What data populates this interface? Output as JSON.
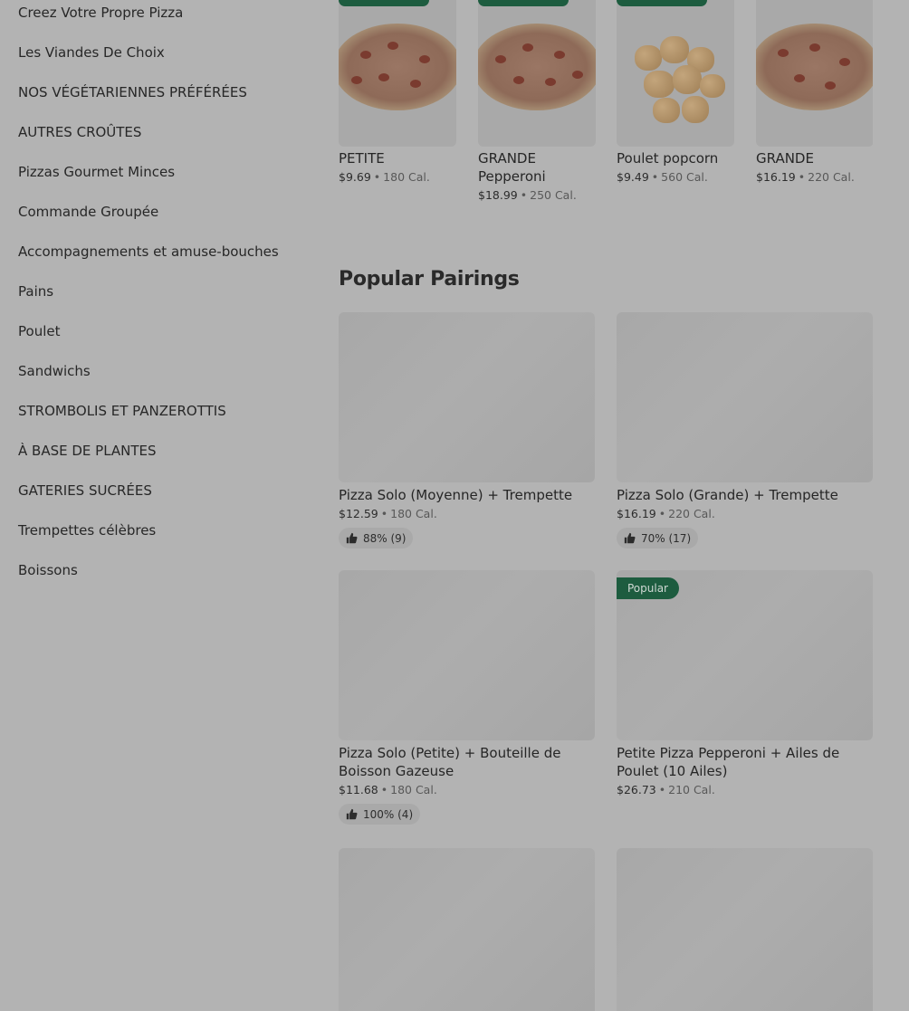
{
  "sidebar": {
    "items": [
      {
        "label": "Creez Votre Propre Pizza"
      },
      {
        "label": "Les Viandes De Choix"
      },
      {
        "label": "NOS VÉGÉTARIENNES PRÉFÉRÉES"
      },
      {
        "label": "AUTRES CROÛTES"
      },
      {
        "label": "Pizzas Gourmet Minces"
      },
      {
        "label": "Commande Groupée"
      },
      {
        "label": "Accompagnements et amuse-bouches"
      },
      {
        "label": "Pains"
      },
      {
        "label": "Poulet"
      },
      {
        "label": "Sandwichs"
      },
      {
        "label": "STROMBOLIS ET PANZEROTTIS"
      },
      {
        "label": "À BASE DE PLANTES"
      },
      {
        "label": "GATERIES SUCRÉES"
      },
      {
        "label": "Trempettes célèbres"
      },
      {
        "label": "Boissons"
      }
    ]
  },
  "carousel": {
    "items": [
      {
        "name": "PETITE",
        "price": "$9.69",
        "cal": "180 Cal.",
        "image": "pizza-image"
      },
      {
        "name": "GRANDE Pepperoni",
        "price": "$18.99",
        "cal": "250 Cal.",
        "image": "pizza-image"
      },
      {
        "name": "Poulet popcorn",
        "price": "$9.49",
        "cal": "560 Cal.",
        "image": "popcorn-chicken-image"
      },
      {
        "name": "GRANDE",
        "price": "$16.19",
        "cal": "220 Cal.",
        "image": "pizza-image"
      }
    ]
  },
  "pairings": {
    "title": "Popular Pairings",
    "cards": [
      {
        "name": "Pizza Solo (Moyenne) + Trempette",
        "price": "$12.59",
        "cal": "180 Cal.",
        "rating": "88% (9)"
      },
      {
        "name": "Pizza Solo (Grande) + Trempette",
        "price": "$16.19",
        "cal": "220 Cal.",
        "rating": "70% (17)"
      },
      {
        "name": "Pizza Solo (Petite) + Bouteille de Boisson Gazeuse",
        "price": "$11.68",
        "cal": "180 Cal.",
        "rating": "100% (4)"
      },
      {
        "name": "Petite Pizza Pepperoni + Ailes de Poulet (10 Ailes)",
        "price": "$26.73",
        "cal": "210 Cal.",
        "badge": "Popular"
      }
    ]
  },
  "separator": "•",
  "icons": {
    "rating": "thumbs-up-icon"
  },
  "colors": {
    "badge": "#1d5c3f",
    "overlay": "#b3b3b3"
  }
}
